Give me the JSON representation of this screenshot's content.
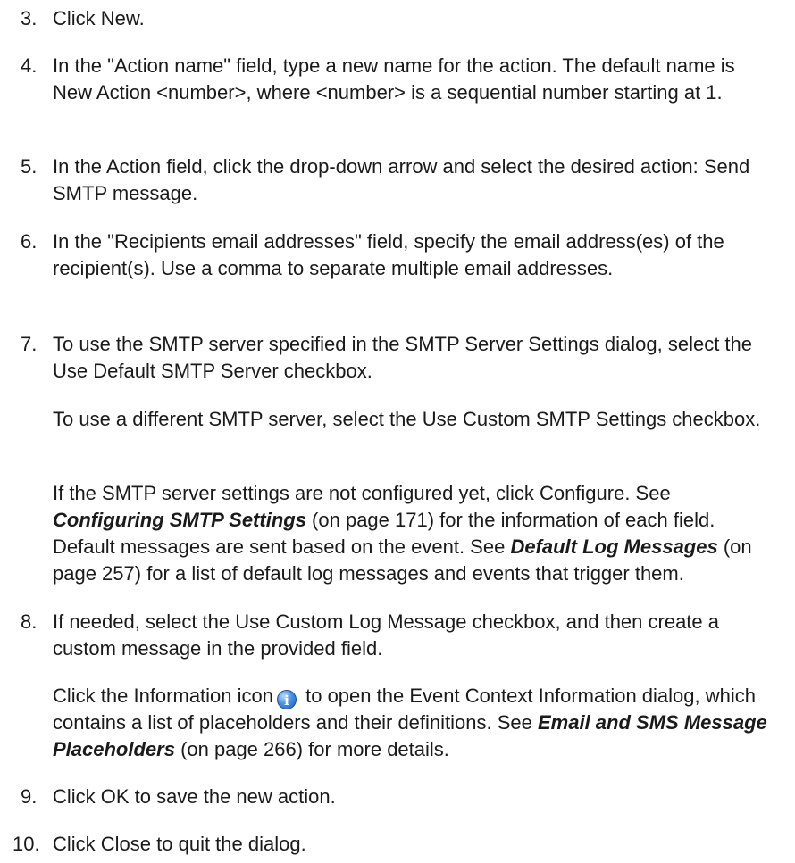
{
  "steps": [
    {
      "num": "3.",
      "text": "Click New."
    },
    {
      "num": "4.",
      "text": "In the \"Action name\" field, type a new name for the action. The default name is New Action <number>, where <number> is a sequential number starting at 1."
    },
    {
      "num": "5.",
      "text": "In the Action field, click the drop-down arrow and select the desired action: Send SMTP message."
    },
    {
      "num": "6.",
      "text": "In the \"Recipients email addresses\" field, specify the email address(es) of the recipient(s). Use a comma to separate multiple email addresses."
    },
    {
      "num": "7.",
      "text": "To use the SMTP server specified in the SMTP Server Settings dialog, select the Use Default SMTP Server checkbox."
    },
    {
      "num": "8.",
      "text": "If needed, select the Use Custom Log Message checkbox, and then create a custom message in the provided field."
    },
    {
      "num": "9.",
      "text": "Click OK to save the new action."
    },
    {
      "num": "10.",
      "text": "Click Close to quit the dialog."
    }
  ],
  "step7": {
    "para2": "To use a different SMTP server, select the Use Custom SMTP Settings checkbox.",
    "para3": {
      "t1": "If the SMTP server settings are not configured yet, click Configure. See ",
      "link1": "Configuring SMTP Settings",
      "t2": " (on page 171) for the information of each field. Default messages are sent based on the event. See ",
      "link2": "Default Log Messages",
      "t3": " (on page 257) for a list of default log messages and events that trigger them."
    }
  },
  "step8": {
    "para2": {
      "t1": "Click the Information icon",
      "icon": "info-icon",
      "t2": " to open the Event Context Information dialog, which contains a list of placeholders and their definitions. See ",
      "link": "Email and SMS Message Placeholders",
      "t3": " (on page 266) for more details."
    }
  }
}
